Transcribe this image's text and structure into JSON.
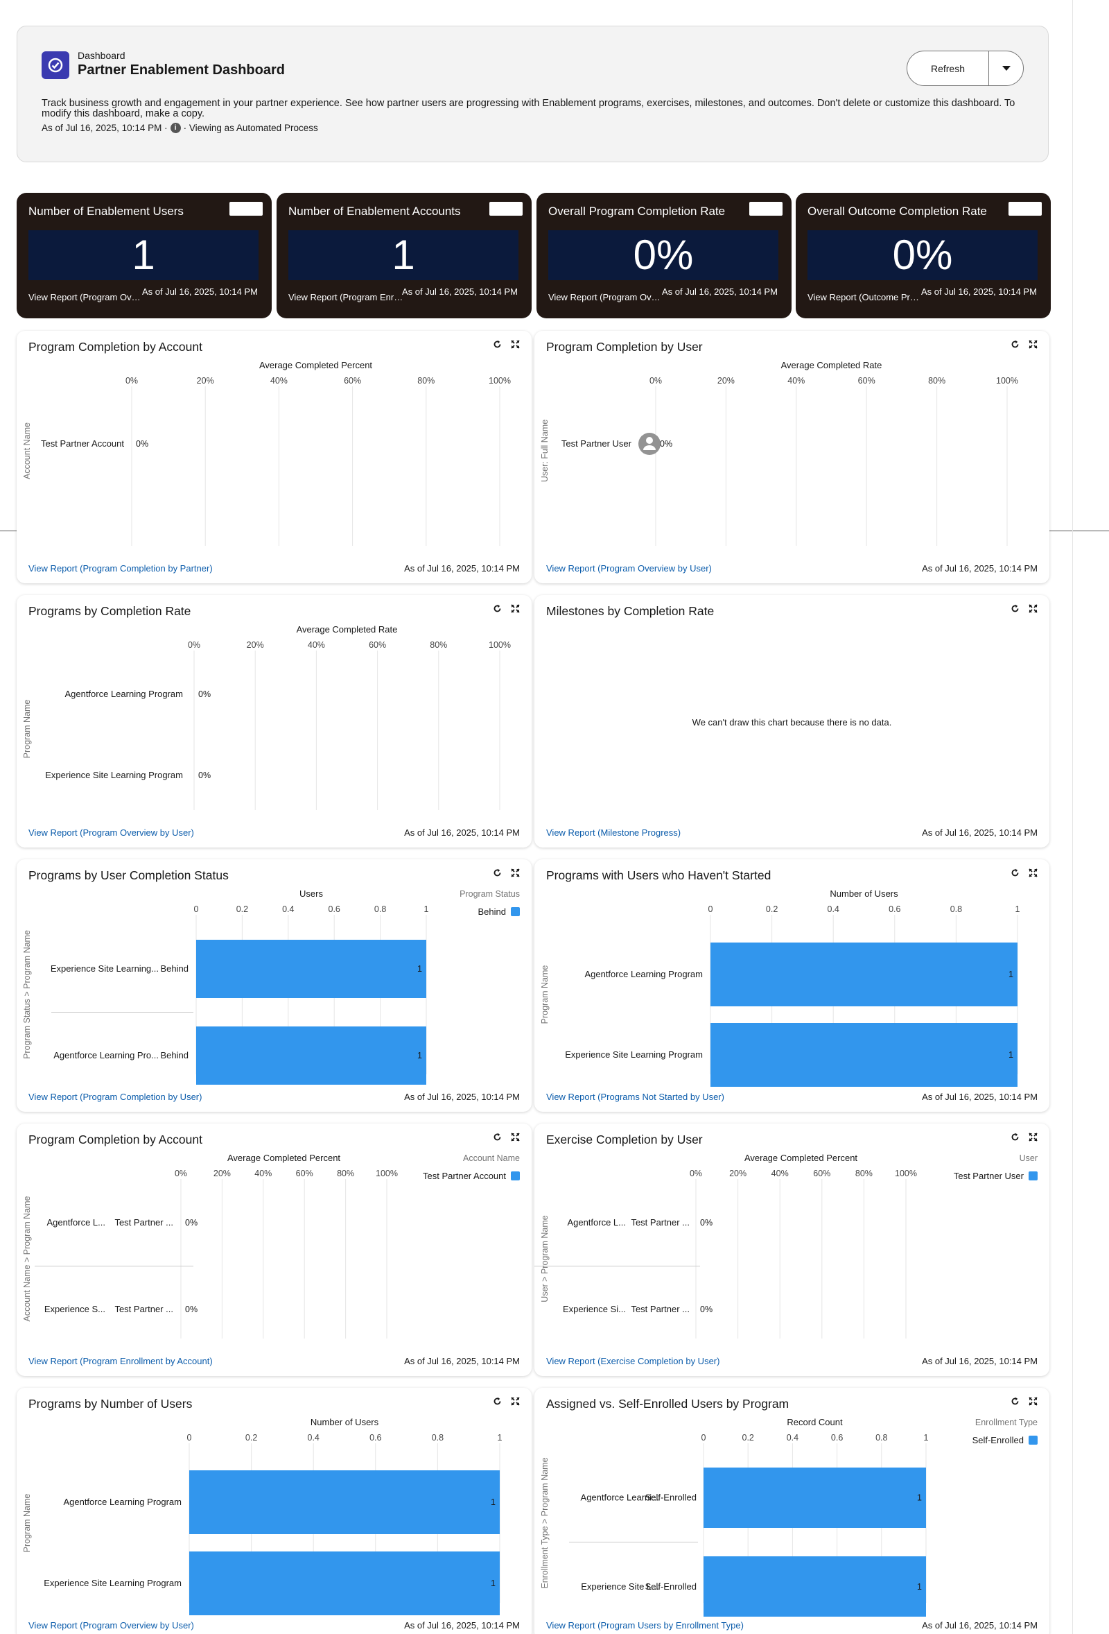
{
  "header": {
    "subtitle": "Dashboard",
    "title": "Partner Enablement Dashboard",
    "description": "Track business growth and engagement in your partner experience. See how partner users are progressing with Enablement programs, exercises, milestones, and outcomes. Don't delete or customize this dashboard. To modify this dashboard, make a copy.",
    "as_of": "As of Jul 16, 2025, 10:14 PM ·",
    "viewing": "· Viewing as Automated Process",
    "refresh_label": "Refresh"
  },
  "kpis": [
    {
      "title": "Number of Enablement Users",
      "value": "1",
      "link": "View Report (Program Overview by User)",
      "as_of": "As of Jul 16, 2025, 10:14 PM"
    },
    {
      "title": "Number of Enablement Accounts",
      "value": "1",
      "link": "View Report (Program Enrollment by Account)",
      "as_of": "As of Jul 16, 2025, 10:14 PM"
    },
    {
      "title": "Overall Program Completion Rate",
      "value": "0%",
      "link": "View Report (Program Overview by User)",
      "as_of": "As of Jul 16, 2025, 10:14 PM"
    },
    {
      "title": "Overall Outcome Completion Rate",
      "value": "0%",
      "link": "View Report (Outcome Progress)",
      "as_of": "As of Jul 16, 2025, 10:14 PM"
    }
  ],
  "colors": {
    "bar": "#3296ed",
    "kpi_bg": "#221814",
    "kpi_panel": "#0b1a3c",
    "link": "#0b5cab",
    "icon_bg": "#3a3ab0"
  },
  "chart_data": [
    {
      "type": "bar",
      "orientation": "horizontal",
      "title": "Program Completion by Account",
      "xlabel": "Average Completed Percent",
      "ylabel": "Account Name",
      "x_ticks": [
        "0%",
        "20%",
        "40%",
        "60%",
        "80%",
        "100%"
      ],
      "xlim": [
        0,
        100
      ],
      "grid": true,
      "categories": [
        "Test Partner Account"
      ],
      "values": [
        0
      ],
      "value_labels": [
        "0%"
      ],
      "link": "View Report (Program Completion by Partner)",
      "as_of": "As of Jul 16, 2025, 10:14 PM"
    },
    {
      "type": "bar",
      "orientation": "horizontal",
      "title": "Program Completion by User",
      "xlabel": "Average Completed Rate",
      "ylabel": "User: Full Name",
      "x_ticks": [
        "0%",
        "20%",
        "40%",
        "60%",
        "80%",
        "100%"
      ],
      "xlim": [
        0,
        100
      ],
      "grid": true,
      "categories": [
        "Test Partner User"
      ],
      "values": [
        0
      ],
      "value_labels": [
        "0%"
      ],
      "avatar": true,
      "link": "View Report (Program Overview by User)",
      "as_of": "As of Jul 16, 2025, 10:14 PM"
    },
    {
      "type": "bar",
      "orientation": "horizontal",
      "title": "Programs by Completion Rate",
      "xlabel": "Average Completed Rate",
      "ylabel": "Program Name",
      "x_ticks": [
        "0%",
        "20%",
        "40%",
        "60%",
        "80%",
        "100%"
      ],
      "xlim": [
        0,
        100
      ],
      "grid": true,
      "categories": [
        "Agentforce Learning Program",
        "Experience Site Learning Program"
      ],
      "values": [
        0,
        0
      ],
      "value_labels": [
        "0%",
        "0%"
      ],
      "link": "View Report (Program Overview by User)",
      "as_of": "As of Jul 16, 2025, 10:14 PM"
    },
    {
      "type": "bar",
      "orientation": "horizontal",
      "title": "Milestones by Completion Rate",
      "no_data": "We can't draw this chart because there is no data.",
      "link": "View Report (Milestone Progress)",
      "as_of": "As of Jul 16, 2025, 10:14 PM"
    },
    {
      "type": "bar",
      "orientation": "horizontal",
      "title": "Programs by User Completion Status",
      "xlabel": "Users",
      "ylabel": "Program Status > Program Name",
      "x_ticks": [
        "0",
        "0.2",
        "0.4",
        "0.6",
        "0.8",
        "1"
      ],
      "xlim": [
        0,
        1
      ],
      "grid": true,
      "categories": [
        "Experience Site Learning...",
        "Agentforce Learning Pro..."
      ],
      "subcategories": [
        "Behind",
        "Behind"
      ],
      "values": [
        1,
        1
      ],
      "value_labels": [
        "1",
        "1"
      ],
      "legend": {
        "title": "Program Status",
        "items": [
          "Behind"
        ],
        "position": "right"
      },
      "link": "View Report (Program Completion by User)",
      "as_of": "As of Jul 16, 2025, 10:14 PM"
    },
    {
      "type": "bar",
      "orientation": "horizontal",
      "title": "Programs with Users who Haven't Started",
      "xlabel": "Number of Users",
      "ylabel": "Program Name",
      "x_ticks": [
        "0",
        "0.2",
        "0.4",
        "0.6",
        "0.8",
        "1"
      ],
      "xlim": [
        0,
        1
      ],
      "grid": true,
      "categories": [
        "Agentforce Learning Program",
        "Experience Site Learning Program"
      ],
      "values": [
        1,
        1
      ],
      "value_labels": [
        "1",
        "1"
      ],
      "link": "View Report (Programs Not Started by User)",
      "as_of": "As of Jul 16, 2025, 10:14 PM"
    },
    {
      "type": "bar",
      "orientation": "horizontal",
      "title": "Program Completion by Account",
      "xlabel": "Average Completed Percent",
      "ylabel": "Account Name > Program Name",
      "x_ticks": [
        "0%",
        "20%",
        "40%",
        "60%",
        "80%",
        "100%"
      ],
      "xlim": [
        0,
        100
      ],
      "grid": true,
      "categories": [
        "Agentforce L...",
        "Experience S..."
      ],
      "subcategories": [
        "Test Partner ...",
        "Test Partner ..."
      ],
      "values": [
        0,
        0
      ],
      "value_labels": [
        "0%",
        "0%"
      ],
      "legend": {
        "title": "Account Name",
        "items": [
          "Test Partner Account"
        ],
        "position": "right"
      },
      "link": "View Report (Program Enrollment by Account)",
      "as_of": "As of Jul 16, 2025, 10:14 PM"
    },
    {
      "type": "bar",
      "orientation": "horizontal",
      "title": "Exercise Completion by User",
      "xlabel": "Average Completed Percent",
      "ylabel": "User > Program Name",
      "x_ticks": [
        "0%",
        "20%",
        "40%",
        "60%",
        "80%",
        "100%"
      ],
      "xlim": [
        0,
        100
      ],
      "grid": true,
      "categories": [
        "Agentforce L...",
        "Experience Si..."
      ],
      "subcategories": [
        "Test Partner ...",
        "Test Partner ..."
      ],
      "values": [
        0,
        0
      ],
      "value_labels": [
        "0%",
        "0%"
      ],
      "legend": {
        "title": "User",
        "items": [
          "Test Partner User"
        ],
        "position": "right"
      },
      "link": "View Report (Exercise Completion by User)",
      "as_of": "As of Jul 16, 2025, 10:14 PM"
    },
    {
      "type": "bar",
      "orientation": "horizontal",
      "title": "Programs by Number of Users",
      "xlabel": "Number of Users",
      "ylabel": "Program Name",
      "x_ticks": [
        "0",
        "0.2",
        "0.4",
        "0.6",
        "0.8",
        "1"
      ],
      "xlim": [
        0,
        1
      ],
      "grid": true,
      "categories": [
        "Agentforce Learning Program",
        "Experience Site Learning Program"
      ],
      "values": [
        1,
        1
      ],
      "value_labels": [
        "1",
        "1"
      ],
      "link": "View Report (Program Overview by User)",
      "as_of": "As of Jul 16, 2025, 10:14 PM"
    },
    {
      "type": "bar",
      "orientation": "horizontal",
      "title": "Assigned vs. Self-Enrolled Users by Program",
      "xlabel": "Record Count",
      "ylabel": "Enrollment Type > Program Name",
      "x_ticks": [
        "0",
        "0.2",
        "0.4",
        "0.6",
        "0.8",
        "1"
      ],
      "xlim": [
        0,
        1
      ],
      "grid": true,
      "categories": [
        "Agentforce Learni...",
        "Experience Site L..."
      ],
      "subcategories": [
        "Self-Enrolled",
        "Self-Enrolled"
      ],
      "values": [
        1,
        1
      ],
      "value_labels": [
        "1",
        "1"
      ],
      "legend": {
        "title": "Enrollment Type",
        "items": [
          "Self-Enrolled"
        ],
        "position": "right"
      },
      "link": "View Report (Program Users by Enrollment Type)",
      "as_of": "As of Jul 16, 2025, 10:14 PM"
    }
  ]
}
